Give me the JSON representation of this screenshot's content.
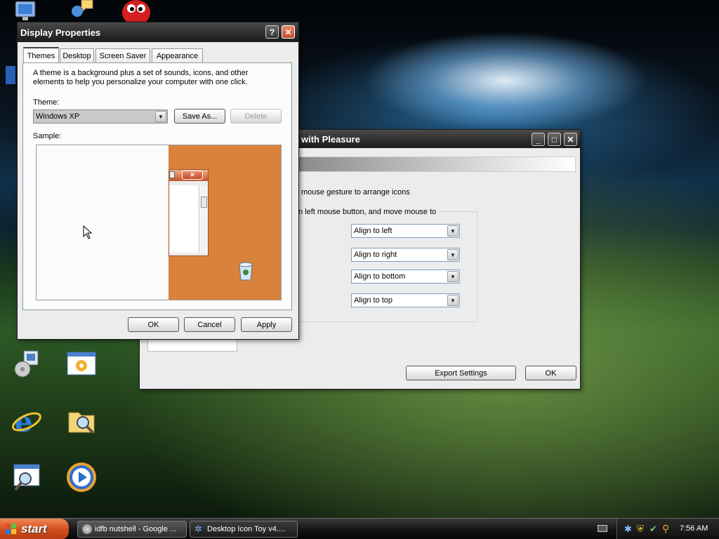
{
  "desktop": {
    "icons": [
      "computer-icon",
      "messenger-icon",
      "buddy-icon",
      "ie-icon",
      "folder-search-icon",
      "install-icon",
      "control-panel-icon",
      "search-window-icon",
      "media-player-icon"
    ]
  },
  "back_window": {
    "title": "with Pleasure",
    "gesture_text": "mouse gesture to arrange icons",
    "group_label": "n left mouse button, and move mouse to",
    "options": [
      "Align to left",
      "Align to right",
      "Align to bottom",
      "Align to top"
    ],
    "export_label": "Export Settings",
    "ok_label": "OK"
  },
  "display_properties": {
    "title": "Display Properties",
    "help_label": "?",
    "tabs": [
      {
        "label": "Themes",
        "active": true
      },
      {
        "label": "Desktop",
        "active": false
      },
      {
        "label": "Screen Saver",
        "active": false
      },
      {
        "label": "Appearance",
        "active": false
      }
    ],
    "description": "A theme is a background plus a set of sounds, icons, and other elements to help you personalize your computer with one click.",
    "theme_label": "Theme:",
    "theme_value": "Windows XP",
    "save_as_label": "Save As...",
    "delete_label": "Delete",
    "sample_label": "Sample:",
    "ok_label": "OK",
    "cancel_label": "Cancel",
    "apply_label": "Apply",
    "colors": {
      "sample_bg": "#d8823c",
      "title_accent": "#c4532a"
    }
  },
  "taskbar": {
    "start_label": "start",
    "items": [
      {
        "label": "idfb nutshell - Google ...",
        "icon": "browser-icon"
      },
      {
        "label": "Desktop Icon Toy v4....",
        "icon": "gear-icon"
      }
    ],
    "time": "7:56 AM"
  }
}
